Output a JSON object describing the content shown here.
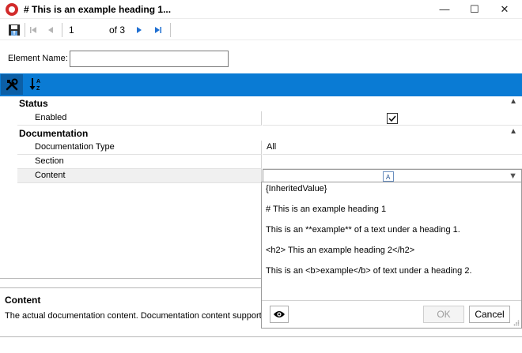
{
  "window": {
    "title": "# This is an example heading 1...",
    "minimize_glyph": "—",
    "maximize_glyph": "☐",
    "close_glyph": "✕"
  },
  "navigation": {
    "current_page": "1",
    "of_label": "of 3"
  },
  "element_name": {
    "label": "Element Name:",
    "value": ""
  },
  "toolbar": {
    "active_color": "#0c5fa6",
    "bar_color": "#0a7bd4"
  },
  "property_grid": {
    "status": {
      "title": "Status",
      "enabled_label": "Enabled",
      "enabled_checked": true,
      "check_glyph": "✓"
    },
    "documentation": {
      "title": "Documentation",
      "type_label": "Documentation Type",
      "type_value": "All",
      "section_label": "Section",
      "section_value": "",
      "content_label": "Content",
      "dropdown_glyph": "▼"
    },
    "collapse_glyph": "▲"
  },
  "description": {
    "title": "Content",
    "text": "The actual documentation content. Documentation content supports"
  },
  "editor_popup": {
    "lines": [
      "{InheritedValue}",
      " # This is an example heading 1",
      "This is an **example** of a text under a heading 1.",
      "<h2> This an example heading 2</h2>",
      "This is an <b>example</b> of text under a heading 2."
    ],
    "ok_label": "OK",
    "cancel_label": "Cancel"
  }
}
